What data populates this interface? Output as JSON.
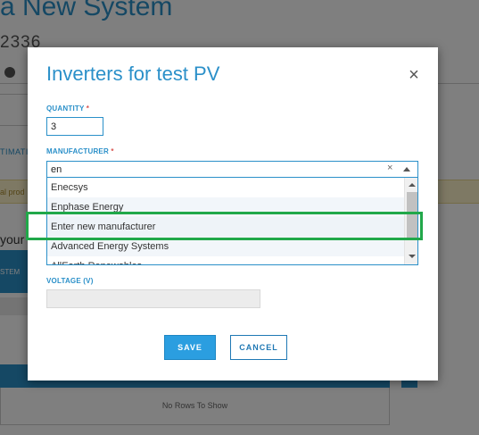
{
  "background": {
    "title": "a New System",
    "subtitle": "2336",
    "estimate_tab": "TIMATI",
    "warning_text": "al prod",
    "your_label": "your",
    "system_button": "STEM",
    "no_rows": "No Rows To Show"
  },
  "modal": {
    "title": "Inverters for test PV",
    "quantity": {
      "label": "QUANTITY",
      "required_mark": "*",
      "value": "3"
    },
    "manufacturer": {
      "label": "MANUFACTURER",
      "required_mark": "*",
      "typed_value": "en",
      "clear_symbol": "×",
      "options": [
        "Enecsys",
        "Enphase Energy",
        "Enter new manufacturer",
        "Advanced Energy Systems",
        "AllEarth Renewables"
      ],
      "highlighted_option": "Enter new manufacturer"
    },
    "voltage": {
      "label": "VOLTAGE (V)",
      "value": ""
    },
    "save_label": "SAVE",
    "cancel_label": "CANCEL",
    "close_symbol": "×"
  },
  "colors": {
    "accent": "#2b90c9",
    "save_button": "#2b9ee0",
    "highlight_border": "#21a84a",
    "required": "#d9534f"
  }
}
